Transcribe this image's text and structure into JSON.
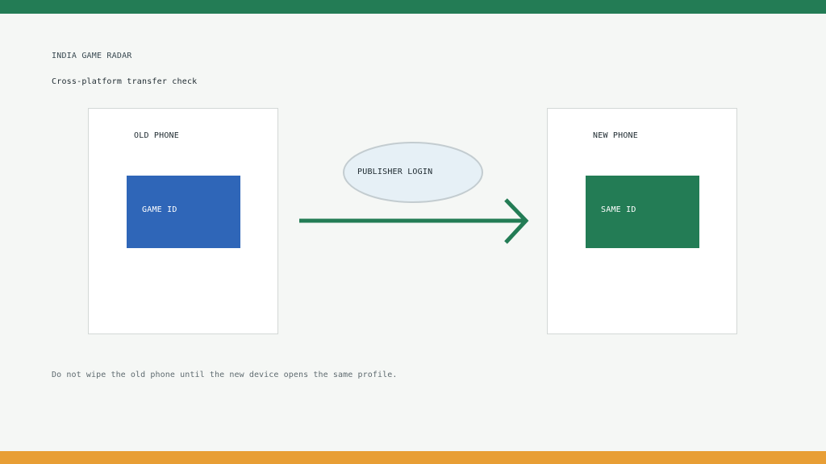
{
  "colors": {
    "top_bar": "#237c55",
    "bottom_bar": "#e89e35",
    "old_id_box": "#2f66b8",
    "new_id_box": "#237c55",
    "arrow": "#237c55",
    "login_fill": "#e6f0f6",
    "login_stroke": "#c3ccd0"
  },
  "header": {
    "brand": "INDIA GAME RADAR",
    "subtitle": "Cross-platform transfer check"
  },
  "diagram": {
    "old_phone": {
      "label": "OLD PHONE",
      "id_label": "GAME ID"
    },
    "new_phone": {
      "label": "NEW PHONE",
      "id_label": "SAME ID"
    },
    "connector": {
      "label": "PUBLISHER LOGIN",
      "icon": "arrow-right-icon"
    }
  },
  "footer": {
    "note": "Do not wipe the old phone until the new device opens the same profile."
  }
}
